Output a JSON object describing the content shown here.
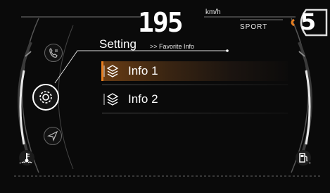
{
  "header": {
    "speed": "195",
    "speed_unit": "km/h",
    "drive_mode": "SPORT",
    "gear": "5"
  },
  "menu": {
    "title": "Setting",
    "breadcrumb": ">> Favorite Info",
    "items": [
      {
        "label": "Info 1",
        "icon": "layers-icon",
        "selected": true
      },
      {
        "label": "Info 2",
        "icon": "layers-icon",
        "selected": false
      }
    ]
  },
  "left_nav": [
    {
      "icon": "phone-icon"
    },
    {
      "icon": "gear-icon",
      "active": true
    },
    {
      "icon": "navigation-arrow-icon"
    }
  ],
  "side_indicators": {
    "left": "coolant-temperature-icon",
    "right": "fuel-pump-icon"
  },
  "colors": {
    "accent": "#e57d1f",
    "background": "#0a0a0a",
    "text": "#ffffff"
  }
}
